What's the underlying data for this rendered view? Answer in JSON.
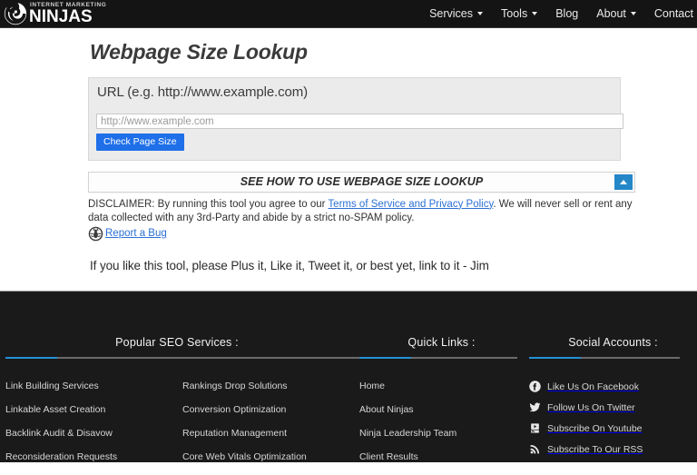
{
  "header": {
    "logo": {
      "tagline": "INTERNET MARKETING",
      "name": "NINJAS",
      "icon": "swirl-logo-icon"
    },
    "nav": [
      {
        "label": "Services",
        "has_dropdown": true
      },
      {
        "label": "Tools",
        "has_dropdown": true
      },
      {
        "label": "Blog",
        "has_dropdown": false
      },
      {
        "label": "About",
        "has_dropdown": true
      },
      {
        "label": "Contact",
        "has_dropdown": false
      }
    ]
  },
  "main": {
    "page_title": "Webpage Size Lookup",
    "form": {
      "field_label": "URL (e.g. http://www.example.com)",
      "url_value": "",
      "url_placeholder": "http://www.example.com",
      "submit_label": "Check Page Size"
    },
    "howto": {
      "title": "SEE HOW TO USE WEBPAGE SIZE LOOKUP",
      "toggle_icon": "triangle-up-icon"
    },
    "disclaimer": {
      "text_before": "DISCLAIMER: By running this tool you agree to our ",
      "link": "Terms of Service and Privacy Policy",
      "text_after": ". We will never sell or rent any data collected with any 3rd-Party and abide by a strict no-SPAM policy."
    },
    "report_bug": {
      "icon": "bug-icon",
      "label": "Report a Bug"
    },
    "promo_line": "If you like this tool, please Plus it, Like it, Tweet it, or best yet, link to it - Jim"
  },
  "footer": {
    "columns": [
      {
        "heading": "Popular SEO Services :",
        "links_left": [
          "Link Building Services",
          "Linkable Asset Creation",
          "Backlink Audit & Disavow",
          "Reconsideration Requests"
        ],
        "links_right": [
          "Rankings Drop Solutions",
          "Conversion Optimization",
          "Reputation Management",
          "Core Web Vitals Optimization"
        ]
      },
      {
        "heading": "Quick Links :",
        "links": [
          "Home",
          "About Ninjas",
          "Ninja Leadership Team",
          "Client Results"
        ]
      },
      {
        "heading": "Social Accounts :",
        "social": [
          {
            "icon": "facebook-icon",
            "label": "Like Us On Facebook"
          },
          {
            "icon": "twitter-icon",
            "label": "Follow Us On Twitter"
          },
          {
            "icon": "youtube-icon",
            "label": "Subscribe On Youtube"
          },
          {
            "icon": "rss-icon",
            "label": "Subscribe To Our RSS"
          }
        ]
      }
    ]
  },
  "colors": {
    "header_bg": "#141414",
    "footer_bg": "#1a1a1a",
    "accent_blue": "#2490d8",
    "button_blue": "#1e6fe8",
    "link_blue": "#2a6fd4",
    "panel_gray": "#ebebeb"
  }
}
